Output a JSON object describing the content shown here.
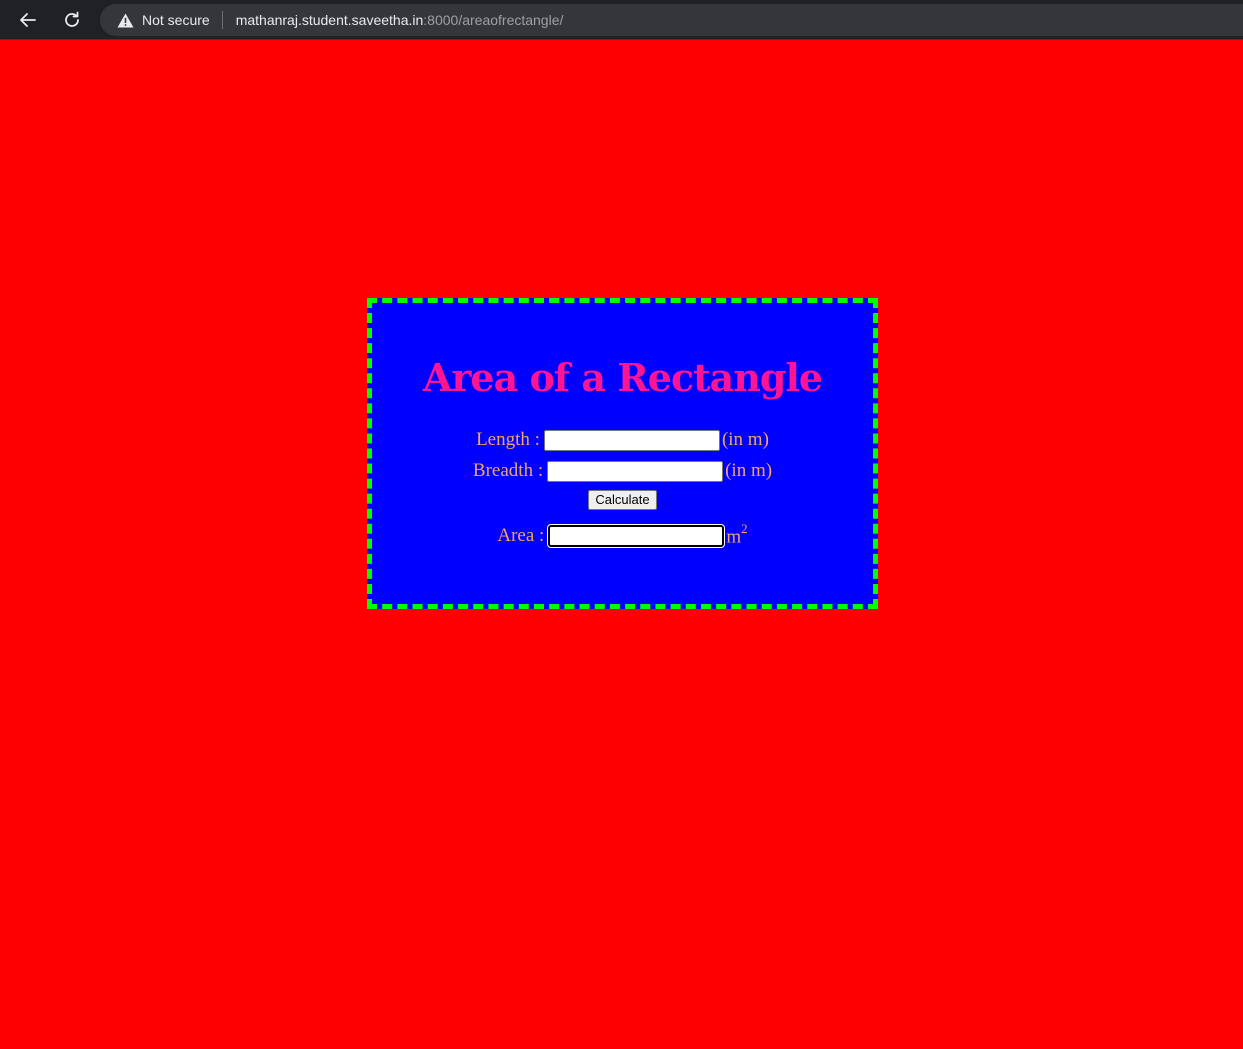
{
  "browser": {
    "security_label": "Not secure",
    "url_host": "mathanraj.student.saveetha.in",
    "url_rest": ":8000/areaofrectangle/"
  },
  "page": {
    "background_color": "#ff0000",
    "card_color": "#0000ff",
    "border_color": "#00ff00",
    "title_color": "#ff1493",
    "label_color": "#f4a460"
  },
  "form": {
    "title": "Area of a Rectangle",
    "length_label": "Length :",
    "length_value": "",
    "length_unit": "(in m)",
    "breadth_label": "Breadth :",
    "breadth_value": "",
    "breadth_unit": "(in m)",
    "calculate_label": "Calculate",
    "area_label": "Area :",
    "area_value": "",
    "area_unit": "m",
    "area_unit_sup": "2"
  }
}
